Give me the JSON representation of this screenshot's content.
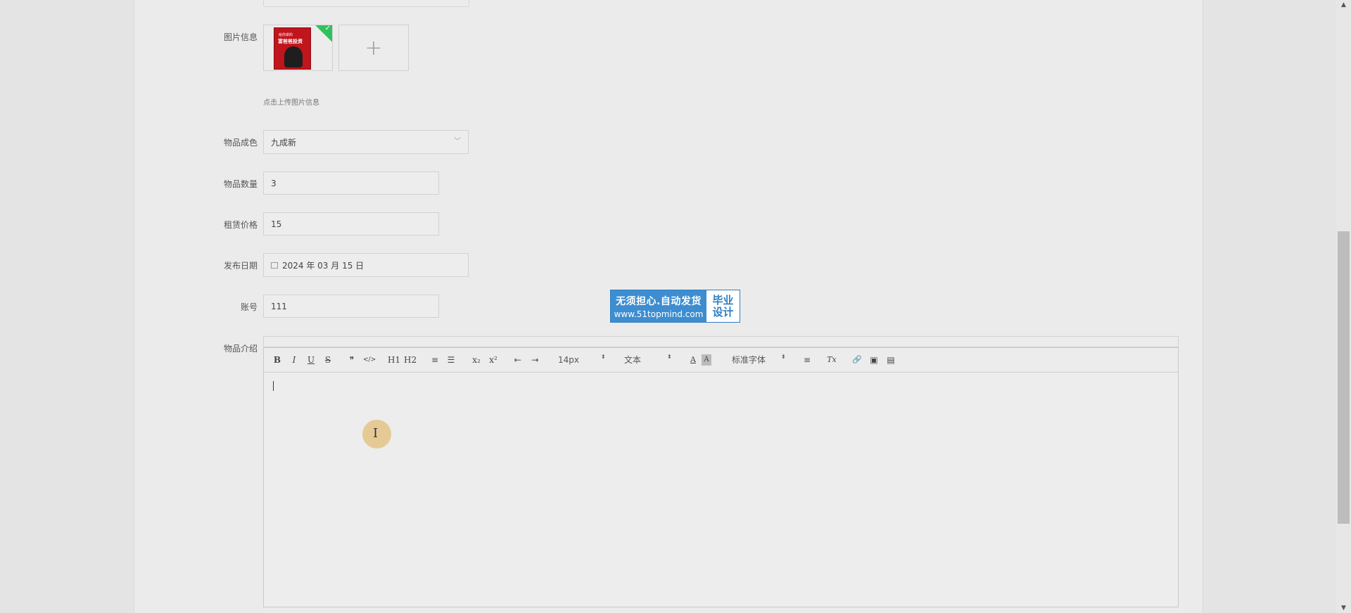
{
  "form": {
    "image_label": "图片信息",
    "image_hint": "点击上传图片信息",
    "add_symbol": "+",
    "book_title_small": "给你讲的",
    "book_title_large": "富爸爸投资",
    "condition_label": "物品成色",
    "condition_value": "九成新",
    "quantity_label": "物品数量",
    "quantity_value": "3",
    "price_label": "租赁价格",
    "price_value": "15",
    "date_label": "发布日期",
    "date_value": "2024 年 03 月 15 日",
    "account_label": "账号",
    "account_value": "111",
    "intro_label": "物品介绍"
  },
  "banner": {
    "line1": "无须担心.自动发货",
    "line2": "www.51topmind.com",
    "right_line1": "毕业",
    "right_line2": "设计"
  },
  "toolbar": {
    "bold": "B",
    "italic": "I",
    "underline": "U",
    "strike": "S",
    "quote": "❞",
    "code": "</>",
    "h1": "H1",
    "h2": "H2",
    "ordered_list": "≡",
    "bullet_list": "☰",
    "subscript": "x₂",
    "superscript": "x²",
    "outdent": "⇤",
    "indent": "⇥",
    "size_value": "14px",
    "header_value": "文本",
    "font_color": "A",
    "bg_color": "A",
    "font_value": "标准字体",
    "align": "≡",
    "clean": "Tx",
    "link": "🔗",
    "image": "▣",
    "video": "▤"
  }
}
